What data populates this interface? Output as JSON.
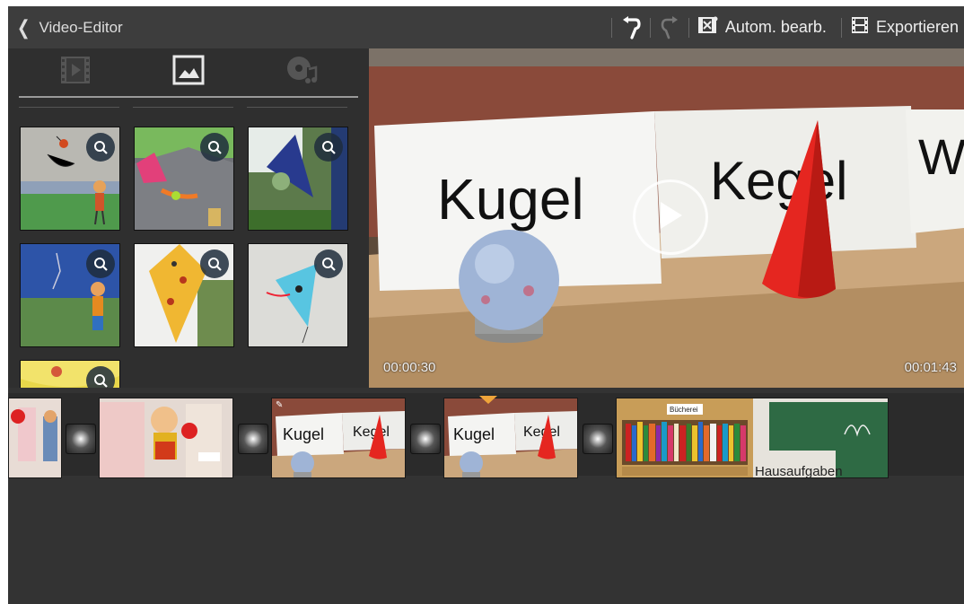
{
  "topbar": {
    "back_icon": "chevron-left-icon",
    "title": "Video-Editor",
    "undo_icon": "undo-icon",
    "redo_icon": "redo-icon",
    "auto_edit_label": "Autom. bearb.",
    "auto_edit_icon": "auto-edit-icon",
    "export_label": "Exportieren",
    "export_icon": "film-export-icon"
  },
  "media_tabs": [
    {
      "icon": "video-clip-icon",
      "active": false
    },
    {
      "icon": "image-icon",
      "active": true
    },
    {
      "icon": "music-icon",
      "active": false
    }
  ],
  "thumbnails": [
    {
      "zoom_icon": "zoom-icon"
    },
    {
      "zoom_icon": "zoom-icon"
    },
    {
      "zoom_icon": "zoom-icon"
    },
    {
      "zoom_icon": "zoom-icon"
    },
    {
      "zoom_icon": "zoom-icon"
    },
    {
      "zoom_icon": "zoom-icon"
    },
    {
      "zoom_icon": "zoom-icon"
    }
  ],
  "preview": {
    "sign_words": [
      "Kugel",
      "Kegel",
      "W"
    ],
    "current_time": "00:00:30",
    "total_time": "00:01:43",
    "play_icon": "play-icon"
  },
  "timeline": {
    "clip_labels": {
      "clip3": [
        "Kugel",
        "Kegel"
      ],
      "clip4": [
        "Kugel",
        "Kegel"
      ],
      "clip5_sign": "Bücherei",
      "clip5_board": "Hausaufgaben"
    },
    "transition_icon": "transition-icon",
    "playhead_icon": "playhead-marker-icon"
  },
  "colors": {
    "bar": "#3d3d3d",
    "panel": "#2f2f2f",
    "accent_marker": "#f0a53a",
    "cone": "#e52620"
  }
}
